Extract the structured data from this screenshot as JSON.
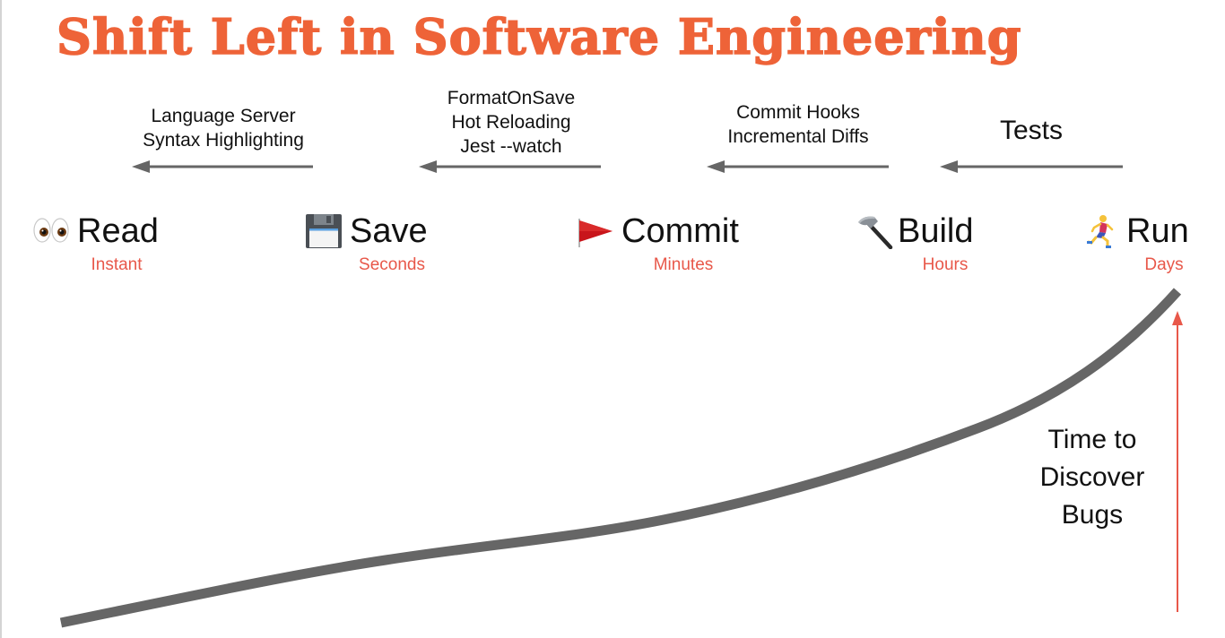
{
  "title": "Shift Left in Software Engineering",
  "colors": {
    "title": "#ee6338",
    "time_label": "#e8584a",
    "curve": "#666666",
    "arrow": "#666666",
    "discover_arrow": "#e8584a"
  },
  "tool_groups": [
    {
      "lines": [
        "Language Server",
        "Syntax Highlighting"
      ]
    },
    {
      "lines": [
        "FormatOnSave",
        "Hot Reloading",
        "Jest --watch"
      ]
    },
    {
      "lines": [
        "Commit Hooks",
        "Incremental Diffs"
      ]
    },
    {
      "lines": [
        "Tests"
      ]
    }
  ],
  "stages": [
    {
      "icon": "eyes-icon",
      "emoji": "👀",
      "label": "Read",
      "time": "Instant"
    },
    {
      "icon": "floppy-disk-icon",
      "emoji": "💾",
      "label": "Save",
      "time": "Seconds"
    },
    {
      "icon": "red-flag-icon",
      "emoji": "🚩",
      "label": "Commit",
      "time": "Minutes"
    },
    {
      "icon": "hammer-icon",
      "emoji": "🔨",
      "label": "Build",
      "time": "Hours"
    },
    {
      "icon": "runner-icon",
      "emoji": "🏃",
      "label": "Run",
      "time": "Days"
    }
  ],
  "annotation": {
    "lines": [
      "Time to",
      "Discover",
      "Bugs"
    ]
  }
}
